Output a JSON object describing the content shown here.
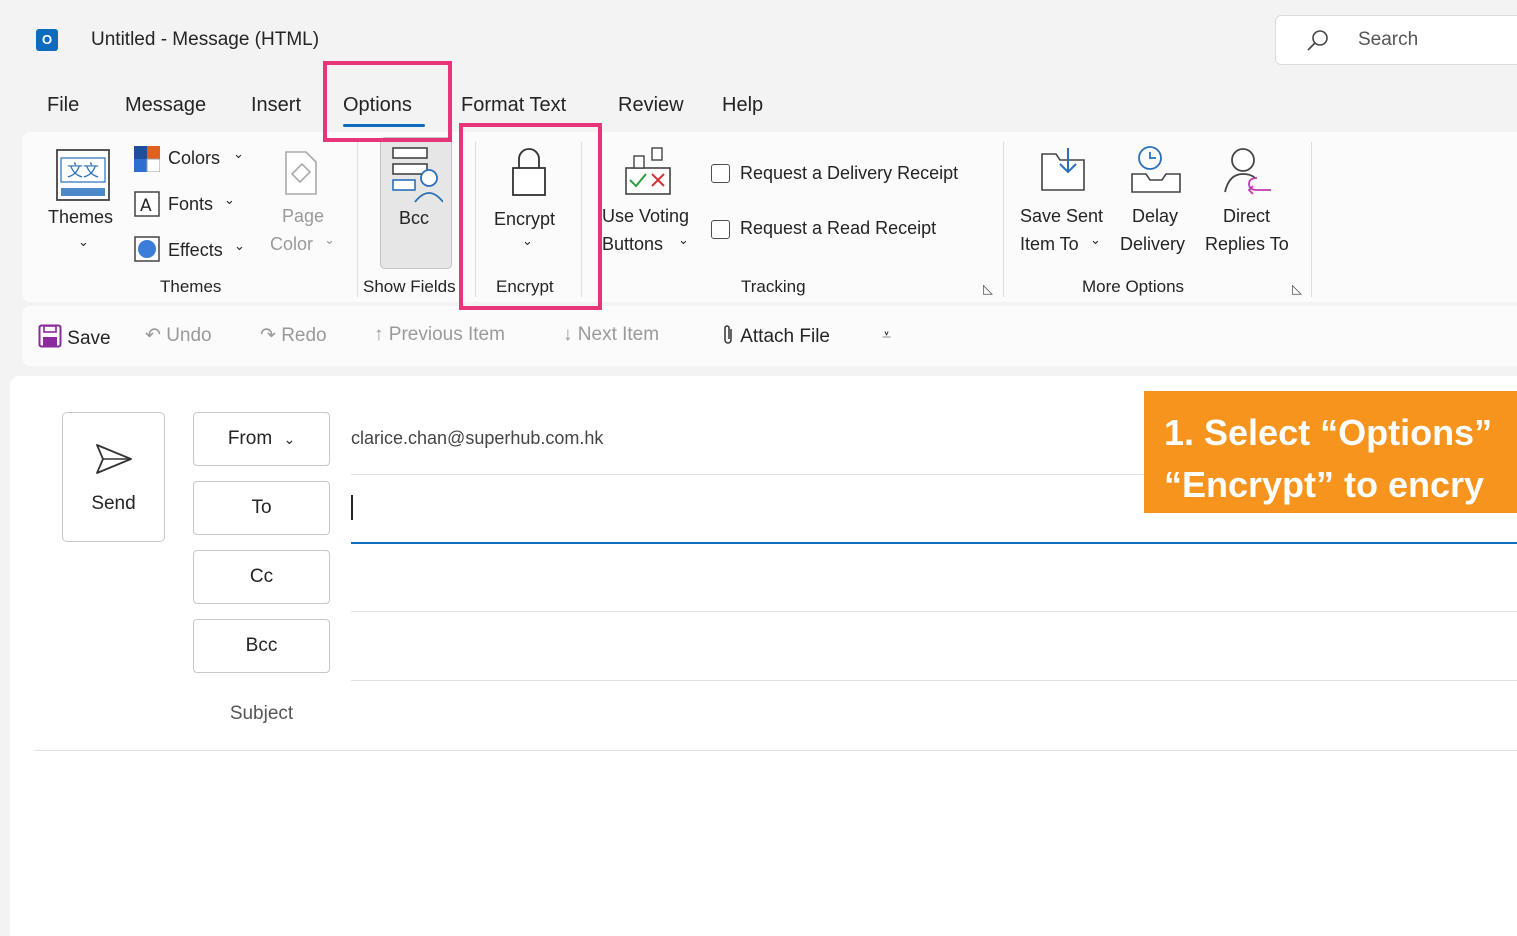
{
  "window": {
    "app_icon_letter": "O",
    "title": "Untitled  -  Message (HTML)",
    "search_placeholder": "Search"
  },
  "menu_tabs": [
    "File",
    "Message",
    "Insert",
    "Options",
    "Format Text",
    "Review",
    "Help"
  ],
  "active_tab": "Options",
  "ribbon": {
    "themes_group": {
      "themes_label": "Themes",
      "colors_label": "Colors",
      "fonts_label": "Fonts",
      "effects_label": "Effects",
      "page_color_line1": "Page",
      "page_color_line2": "Color",
      "group_label": "Themes"
    },
    "show_fields_group": {
      "bcc_label": "Bcc",
      "group_label": "Show Fields"
    },
    "encrypt_group": {
      "encrypt_label": "Encrypt",
      "group_label": "Encrypt"
    },
    "tracking_group": {
      "voting_line1": "Use Voting",
      "voting_line2": "Buttons",
      "delivery_receipt": "Request a Delivery Receipt",
      "read_receipt": "Request a Read Receipt",
      "group_label": "Tracking"
    },
    "more_options_group": {
      "save_sent_line1": "Save Sent",
      "save_sent_line2": "Item To",
      "delay_line1": "Delay",
      "delay_line2": "Delivery",
      "direct_line1": "Direct",
      "direct_line2": "Replies To",
      "group_label": "More Options"
    }
  },
  "quick_access": {
    "save": "Save",
    "undo": "Undo",
    "redo": "Redo",
    "previous_item": "Previous Item",
    "next_item": "Next Item",
    "attach_file": "Attach File"
  },
  "compose": {
    "send": "Send",
    "from_button": "From",
    "from_address": "clarice.chan@superhub.com.hk",
    "to_button": "To",
    "cc_button": "Cc",
    "bcc_button": "Bcc",
    "subject_label": "Subject"
  },
  "callout": {
    "line1": "1. Select “Options”",
    "line2": "“Encrypt” to encry"
  },
  "colors": {
    "highlight": "#e8357a",
    "callout_bg": "#f7941d",
    "accent": "#0f6cbd"
  }
}
